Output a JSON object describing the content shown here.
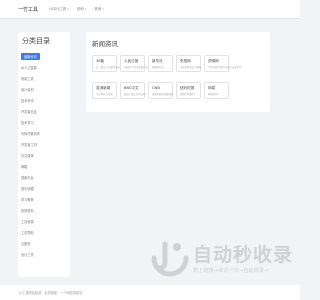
{
  "header": {
    "brand": "一竹工具",
    "nav": [
      {
        "label": "UEDQ工具",
        "has_caret": true
      },
      {
        "label": "其他",
        "has_caret": true
      },
      {
        "label": "其他",
        "has_caret": true
      }
    ]
  },
  "sidebar": {
    "title": "分类目录",
    "items": [
      {
        "label": "最新资讯",
        "active": true
      },
      {
        "label": "AI人工智能"
      },
      {
        "label": "常用工具"
      },
      {
        "label": "设计素材"
      },
      {
        "label": "技术资讯"
      },
      {
        "label": "开发者社区"
      },
      {
        "label": "技术学习"
      },
      {
        "label": "代码托管协作"
      },
      {
        "label": "开发者工具"
      },
      {
        "label": "社交媒体"
      },
      {
        "label": "邮箱"
      },
      {
        "label": "视频平台"
      },
      {
        "label": "音乐收藏"
      },
      {
        "label": "学习教育"
      },
      {
        "label": "影视软件"
      },
      {
        "label": "工具资源"
      },
      {
        "label": "工具导航"
      },
      {
        "label": "云服务"
      },
      {
        "label": "设计工作"
      }
    ]
  },
  "main": {
    "section_title": "新闻资讯",
    "cards": [
      {
        "title": "36氪",
        "desc": "让一部分人先看到未来"
      },
      {
        "title": "人民日报",
        "desc": "中国共产党中央委员会机关报"
      },
      {
        "title": "新华社",
        "desc": "国家通讯社"
      },
      {
        "title": "央视网",
        "desc": "中央电视台官方网站"
      },
      {
        "title": "虎嗅网",
        "desc": "个性化商业资讯与观点交流平台"
      },
      {
        "title": "澎湃新闻",
        "desc": "专注时政与思想"
      },
      {
        "title": "BBC中文",
        "desc": "英国广播公司中文网"
      },
      {
        "title": "CNN",
        "desc": "美国有线电视新闻网"
      },
      {
        "title": "纽约时报",
        "desc": "美国严肃报刊"
      },
      {
        "title": "网易",
        "desc": "网易新闻"
      }
    ]
  },
  "watermark": {
    "title": "自动秒收录",
    "subtitle": "数上链接→来访一次→自动收录→"
  },
  "footer": {
    "text": "以工具网站精选 · 友情链接 · 一个网站导航站"
  }
}
